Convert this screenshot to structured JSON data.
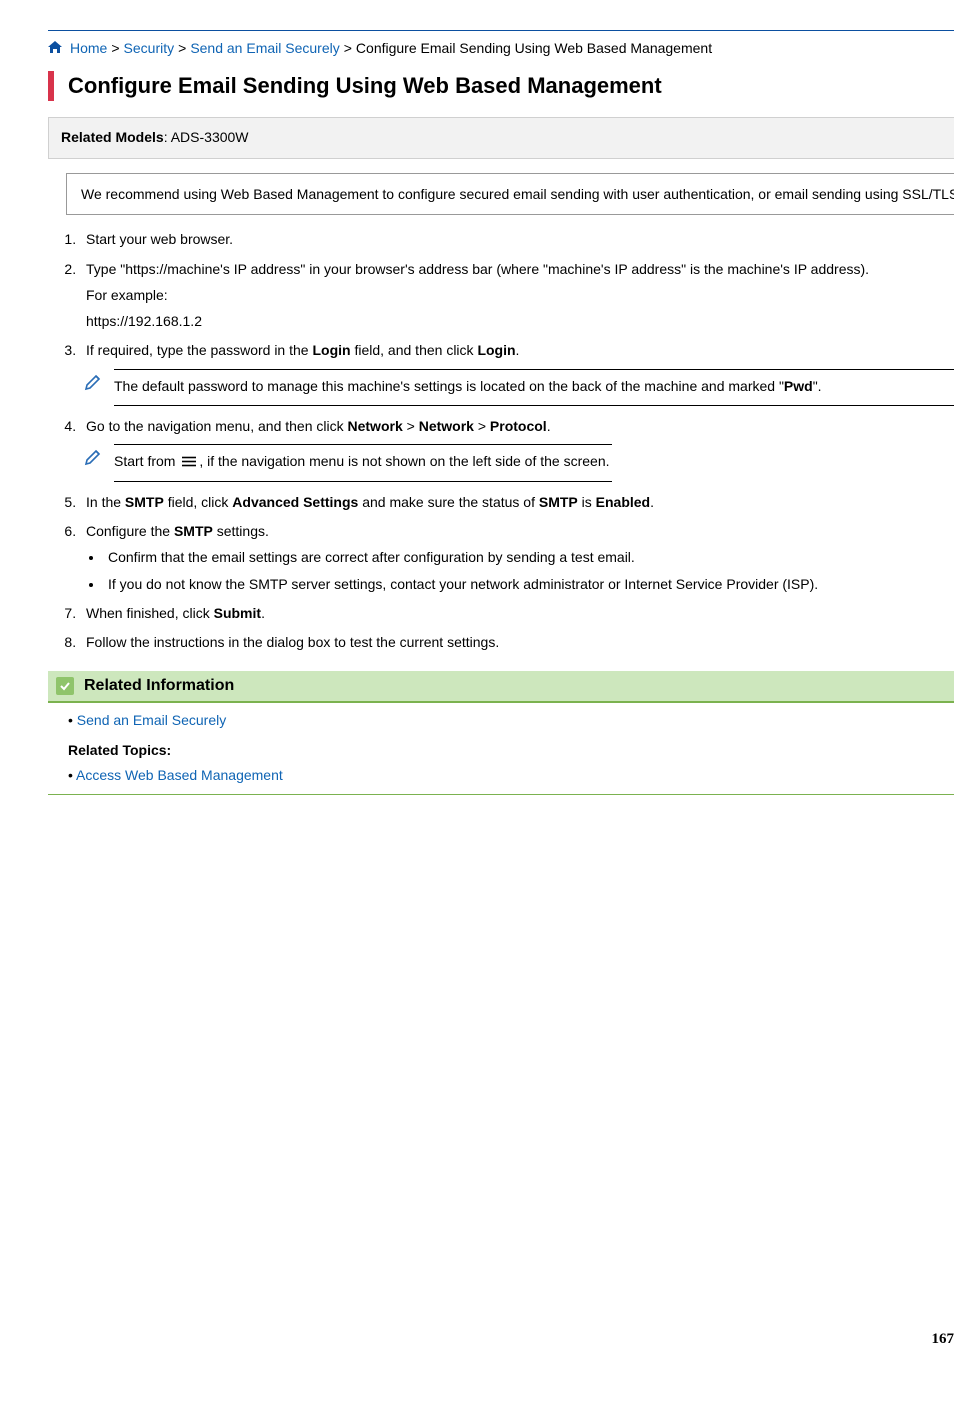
{
  "breadcrumb": {
    "home": "Home",
    "security": "Security",
    "send_email": "Send an Email Securely",
    "current": "Configure Email Sending Using Web Based Management"
  },
  "page_title": "Configure Email Sending Using Web Based Management",
  "related_models_label": "Related Models",
  "related_models_value": ": ADS-3300W",
  "recommend_text": "We recommend using Web Based Management to configure secured email sending with user authentication, or email sending using SSL/TLS.",
  "steps": {
    "s1": "Start your web browser.",
    "s2": "Type \"https://machine's IP address\" in your browser's address bar (where \"machine's IP address\" is the machine's IP address).",
    "s2_example_label": "For example:",
    "s2_example_value": "https://192.168.1.2",
    "s3_a": "If required, type the password in the ",
    "s3_b": "Login",
    "s3_c": " field, and then click ",
    "s3_d": "Login",
    "s3_e": ".",
    "note3_a": "The default password to manage this machine's settings is located on the back of the machine and marked \"",
    "note3_b": "Pwd",
    "note3_c": "\".",
    "s4_a": "Go to the navigation menu, and then click ",
    "s4_b": "Network",
    "s4_c": " > ",
    "s4_d": "Network",
    "s4_e": " > ",
    "s4_f": "Protocol",
    "s4_g": ".",
    "note4_a": "Start from ",
    "note4_b": ", if the navigation menu is not shown on the left side of the screen.",
    "s5_a": "In the ",
    "s5_b": "SMTP",
    "s5_c": " field, click ",
    "s5_d": "Advanced Settings",
    "s5_e": " and make sure the status of ",
    "s5_f": "SMTP",
    "s5_g": " is ",
    "s5_h": "Enabled",
    "s5_i": ".",
    "s6_a": "Configure the ",
    "s6_b": "SMTP",
    "s6_c": " settings.",
    "s6_bullet1": "Confirm that the email settings are correct after configuration by sending a test email.",
    "s6_bullet2": "If you do not know the SMTP server settings, contact your network administrator or Internet Service Provider (ISP).",
    "s7_a": "When finished, click ",
    "s7_b": "Submit",
    "s7_c": ".",
    "s8": "Follow the instructions in the dialog box to test the current settings."
  },
  "related_info_heading": "Related Information",
  "related_info_link": "Send an Email Securely",
  "related_topics_label": "Related Topics:",
  "related_topics_link": "Access Web Based Management",
  "page_number": "167"
}
